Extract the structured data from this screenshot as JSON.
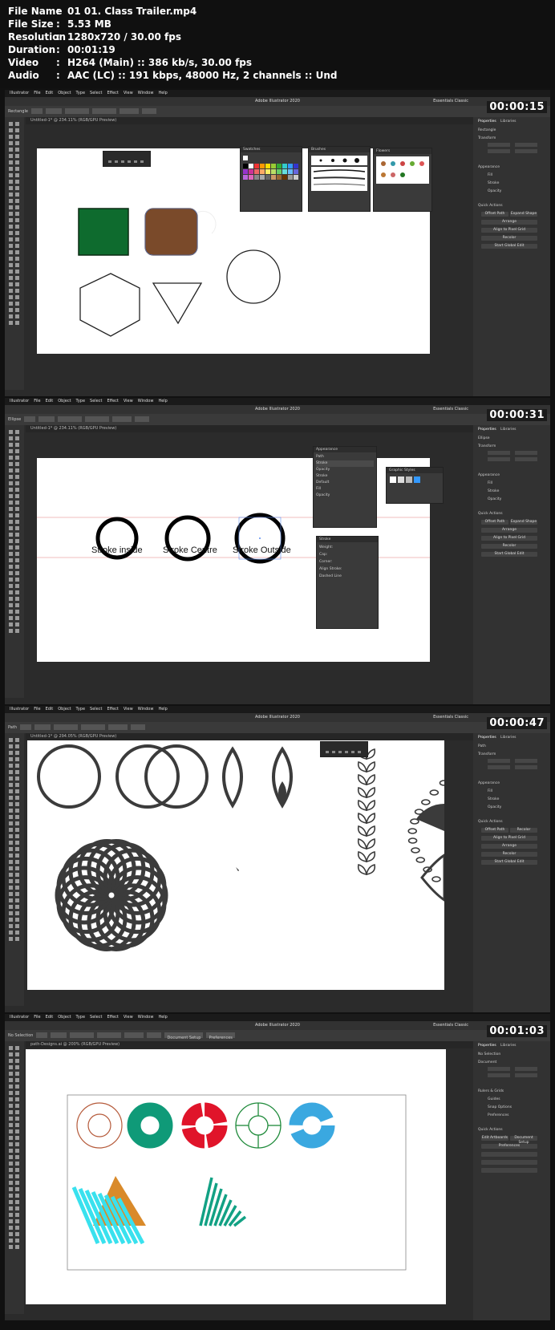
{
  "info": {
    "rows": [
      {
        "key": "File Name",
        "value": "01 01. Class Trailer.mp4"
      },
      {
        "key": "File Size",
        "value": "5.53 MB"
      },
      {
        "key": "Resolution",
        "value": "1280x720 / 30.00 fps"
      },
      {
        "key": "Duration",
        "value": "00:01:19"
      },
      {
        "key": "Video",
        "value": "H264 (Main) :: 386 kb/s, 30.00 fps"
      },
      {
        "key": "Audio",
        "value": "AAC (LC) :: 191 kbps, 48000 Hz, 2 channels :: Und"
      }
    ]
  },
  "app": {
    "menu": [
      "Illustrator",
      "File",
      "Edit",
      "Object",
      "Type",
      "Select",
      "Effect",
      "View",
      "Window",
      "Help"
    ],
    "title": "Adobe Illustrator 2020",
    "workspace": "Essentials Classic"
  },
  "frames": [
    {
      "timecode": "00:00:15",
      "tool_label": "Rectangle",
      "doc_tab": "Untitled-1* @ 234.11% (RGB/GPU Preview)",
      "panels": {
        "swatches": "Swatches",
        "brushes": "Brushes",
        "flowers": "Flowers"
      },
      "props": {
        "tabs": [
          "Properties",
          "Libraries"
        ],
        "section": "Rectangle",
        "transform": "Transform",
        "appearance": "Appearance",
        "fill": "Fill",
        "stroke": "Stroke",
        "opacity": "Opacity",
        "quick_actions": "Quick Actions",
        "btn1": "Offset Path",
        "btn2": "Expand Shape",
        "btn3": "Arrange",
        "btn4": "Align to Pixel Grid",
        "btn5": "Recolor",
        "btn6": "Start Global Edit"
      }
    },
    {
      "timecode": "00:00:31",
      "tool_label": "Ellipse",
      "doc_tab": "Untitled-1* @ 234.11% (RGB/GPU Preview)",
      "labels": [
        "Stroke inside",
        "Stroke Centre",
        "Stroke Outside"
      ],
      "panels": {
        "appearance": "Appearance",
        "path": "Path",
        "stroke": "Stroke",
        "opacity": "Opacity",
        "default": "Default",
        "fill": "Fill",
        "graphic_styles": "Graphic Styles",
        "stroke_panel": "Stroke",
        "weight": "Weight:",
        "cap": "Cap:",
        "corner": "Corner:",
        "limit": "Limit:",
        "align": "Align Stroke:",
        "dashed": "Dashed Line"
      },
      "props": {
        "tabs": [
          "Properties",
          "Libraries"
        ],
        "section": "Ellipse",
        "transform": "Transform",
        "appearance": "Appearance",
        "fill": "Fill",
        "stroke": "Stroke",
        "opacity": "Opacity",
        "quick_actions": "Quick Actions",
        "btn1": "Offset Path",
        "btn2": "Expand Shape",
        "btn3": "Arrange",
        "btn4": "Align to Pixel Grid",
        "btn5": "Recolor",
        "btn6": "Start Global Edit"
      }
    },
    {
      "timecode": "00:00:47",
      "tool_label": "Path",
      "doc_tab": "Untitled-1* @ 294.05% (RGB/GPU Preview)",
      "props": {
        "tabs": [
          "Properties",
          "Libraries"
        ],
        "section": "Path",
        "transform": "Transform",
        "appearance": "Appearance",
        "fill": "Fill",
        "stroke": "Stroke",
        "opacity": "Opacity",
        "quick_actions": "Quick Actions",
        "btn1": "Offset Path",
        "btn2": "Recolor",
        "btn3": "Align to Pixel Grid",
        "btn4": "Arrange",
        "btn5": "Recolor",
        "btn6": "Start Global Edit"
      }
    },
    {
      "timecode": "00:01:03",
      "tool_label": "No Selection",
      "doc_tab": "path-Designs.ai @ 200% (RGB/GPU Preview)",
      "tb_extra": [
        "Document Setup",
        "Preferences"
      ],
      "props": {
        "tabs": [
          "Properties",
          "Libraries"
        ],
        "section": "No Selection",
        "transform": "Document",
        "appearance": "Rulers & Grids",
        "fill": "Guides",
        "stroke": "Snap Options",
        "opacity": "Preferences",
        "quick_actions": "Quick Actions",
        "btn1": "Edit Artboards",
        "btn2": "Document Setup",
        "btn3": "Preferences",
        "btn4": "",
        "btn5": "",
        "btn6": ""
      }
    }
  ],
  "colors": {
    "green_square": "#0e6b2e",
    "brown_rounded": "#7a4a2a",
    "teal": "#0f9a78",
    "red": "#e0142a",
    "blue": "#3aa8e0",
    "cyan": "#39e1ee",
    "orange": "#d98a2a"
  }
}
